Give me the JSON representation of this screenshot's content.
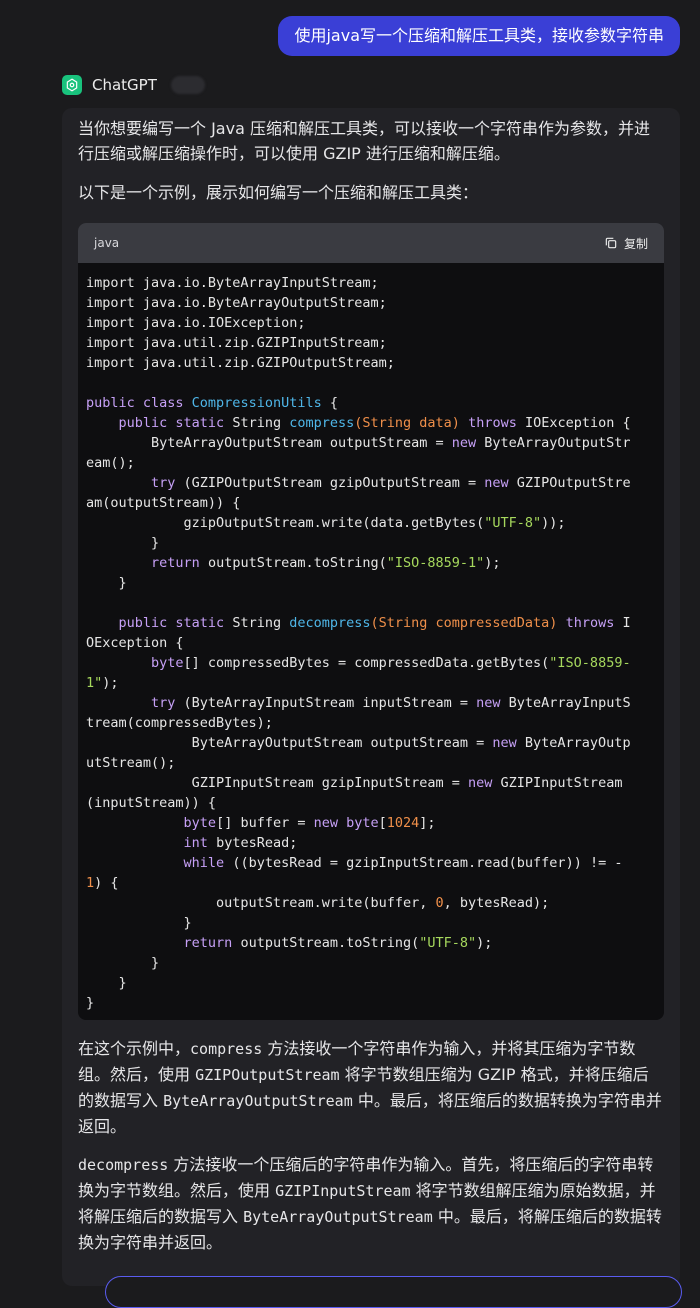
{
  "user_message": "使用java写一个压缩和解压工具类，接收参数字符串",
  "assistant": {
    "name": "ChatGPT",
    "intro_p1": "当你想要编写一个 Java 压缩和解压工具类，可以接收一个字符串作为参数，并进行压缩或解压缩操作时，可以使用 GZIP 进行压缩和解压缩。",
    "intro_p2": "以下是一个示例，展示如何编写一个压缩和解压工具类：",
    "code_block": {
      "language": "java",
      "copy_label": "复制"
    },
    "outro_p1": {
      "a": "在这个示例中，",
      "m1": "compress",
      "b": " 方法接收一个字符串作为输入，并将其压缩为字节数组。然后，使用 ",
      "m2": "GZIPOutputStream",
      "c": " 将字节数组压缩为 GZIP 格式，并将压缩后的数据写入 ",
      "m3": "ByteArrayOutputStream",
      "d": " 中。最后，将压缩后的数据转换为字符串并返回。"
    },
    "outro_p2": {
      "m1": "decompress",
      "a": " 方法接收一个压缩后的字符串作为输入。首先，将压缩后的字符串转换为字节数组。然后，使用 ",
      "m2": "GZIPInputStream",
      "b": " 将字节数组解压缩为原始数据，并将解压缩后的数据写入 ",
      "m3": "ByteArrayOutputStream",
      "c": " 中。最后，将解压缩后的数据转换为字符串并返回。"
    }
  },
  "code_lines": [
    [
      [
        "import java.io.ByteArrayInputStream;",
        ""
      ]
    ],
    [
      [
        "import java.io.ByteArrayOutputStream;",
        ""
      ]
    ],
    [
      [
        "import java.io.IOException;",
        ""
      ]
    ],
    [
      [
        "import java.util.zip.GZIPInputStream;",
        ""
      ]
    ],
    [
      [
        "import java.util.zip.GZIPOutputStream;",
        ""
      ]
    ],
    [
      [
        "",
        ""
      ]
    ],
    [
      [
        "public class ",
        "kw"
      ],
      [
        "CompressionUtils",
        "fn"
      ],
      [
        " {",
        ""
      ]
    ],
    [
      [
        "    ",
        ""
      ],
      [
        "public static ",
        "kw"
      ],
      [
        "String ",
        ""
      ],
      [
        "compress",
        "fn"
      ],
      [
        "(String data)",
        "param"
      ],
      [
        " ",
        ""
      ],
      [
        "throws ",
        "kw"
      ],
      [
        "IOException {",
        ""
      ]
    ],
    [
      [
        "        ByteArrayOutputStream outputStream = ",
        ""
      ],
      [
        "new ",
        "kw"
      ],
      [
        "ByteArrayOutputStr",
        ""
      ]
    ],
    [
      [
        "eam();",
        ""
      ]
    ],
    [
      [
        "        ",
        ""
      ],
      [
        "try ",
        "kw"
      ],
      [
        "(GZIPOutputStream gzipOutputStream = ",
        ""
      ],
      [
        "new ",
        "kw"
      ],
      [
        "GZIPOutputStre",
        ""
      ]
    ],
    [
      [
        "am(outputStream)) {",
        ""
      ]
    ],
    [
      [
        "            gzipOutputStream.write(data.getBytes(",
        ""
      ],
      [
        "\"UTF-8\"",
        "str"
      ],
      [
        "));",
        ""
      ]
    ],
    [
      [
        "        }",
        ""
      ]
    ],
    [
      [
        "        ",
        ""
      ],
      [
        "return ",
        "kw"
      ],
      [
        "outputStream.toString(",
        ""
      ],
      [
        "\"ISO-8859-1\"",
        "str"
      ],
      [
        ");",
        ""
      ]
    ],
    [
      [
        "    }",
        ""
      ]
    ],
    [
      [
        "",
        ""
      ]
    ],
    [
      [
        "    ",
        ""
      ],
      [
        "public static ",
        "kw"
      ],
      [
        "String ",
        ""
      ],
      [
        "decompress",
        "fn"
      ],
      [
        "(String compressedData)",
        "param"
      ],
      [
        " ",
        ""
      ],
      [
        "throws ",
        "kw"
      ],
      [
        "I",
        ""
      ]
    ],
    [
      [
        "OException {",
        ""
      ]
    ],
    [
      [
        "        ",
        ""
      ],
      [
        "byte",
        "kw"
      ],
      [
        "[] compressedBytes = compressedData.getBytes(",
        ""
      ],
      [
        "\"ISO-8859-",
        "str"
      ]
    ],
    [
      [
        "1\"",
        "str"
      ],
      [
        ");",
        ""
      ]
    ],
    [
      [
        "        ",
        ""
      ],
      [
        "try ",
        "kw"
      ],
      [
        "(ByteArrayInputStream inputStream = ",
        ""
      ],
      [
        "new ",
        "kw"
      ],
      [
        "ByteArrayInputS",
        ""
      ]
    ],
    [
      [
        "tream(compressedBytes);",
        ""
      ]
    ],
    [
      [
        "             ByteArrayOutputStream outputStream = ",
        ""
      ],
      [
        "new ",
        "kw"
      ],
      [
        "ByteArrayOutp",
        ""
      ]
    ],
    [
      [
        "utStream();",
        ""
      ]
    ],
    [
      [
        "             GZIPInputStream gzipInputStream = ",
        ""
      ],
      [
        "new ",
        "kw"
      ],
      [
        "GZIPInputStream",
        ""
      ]
    ],
    [
      [
        "(inputStream)) {",
        ""
      ]
    ],
    [
      [
        "            ",
        ""
      ],
      [
        "byte",
        "kw"
      ],
      [
        "[] buffer = ",
        ""
      ],
      [
        "new byte",
        "kw"
      ],
      [
        "[",
        ""
      ],
      [
        "1024",
        "num"
      ],
      [
        "];",
        ""
      ]
    ],
    [
      [
        "            ",
        ""
      ],
      [
        "int ",
        "kw"
      ],
      [
        "bytesRead;",
        ""
      ]
    ],
    [
      [
        "            ",
        ""
      ],
      [
        "while ",
        "kw"
      ],
      [
        "((bytesRead = gzipInputStream.read(buffer)) != -",
        ""
      ]
    ],
    [
      [
        "1",
        "num"
      ],
      [
        ") {",
        ""
      ]
    ],
    [
      [
        "                outputStream.write(buffer, ",
        ""
      ],
      [
        "0",
        "num"
      ],
      [
        ", bytesRead);",
        ""
      ]
    ],
    [
      [
        "            }",
        ""
      ]
    ],
    [
      [
        "            ",
        ""
      ],
      [
        "return ",
        "kw"
      ],
      [
        "outputStream.toString(",
        ""
      ],
      [
        "\"UTF-8\"",
        "str"
      ],
      [
        ");",
        ""
      ]
    ],
    [
      [
        "        }",
        ""
      ]
    ],
    [
      [
        "    }",
        ""
      ]
    ],
    [
      [
        "}",
        ""
      ]
    ]
  ]
}
